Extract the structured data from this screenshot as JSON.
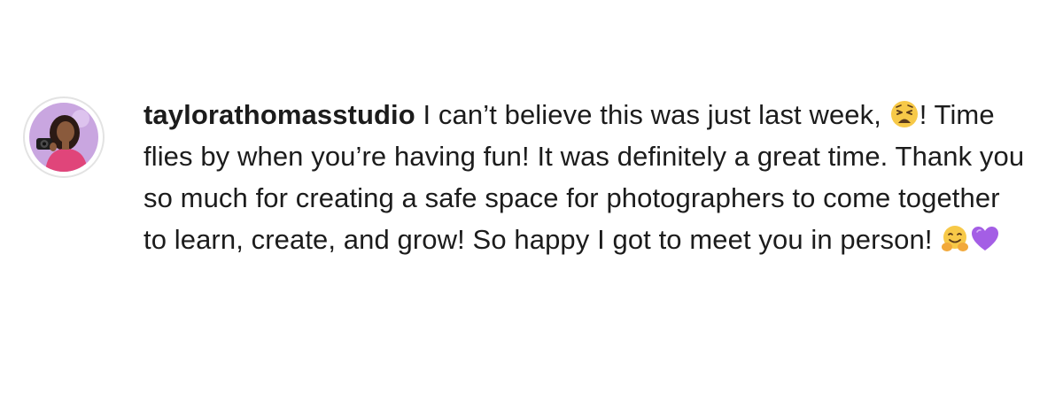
{
  "comment": {
    "username": "taylorathomasstudio",
    "text_part1": " I can’t believe this was just last week, ",
    "text_part2": "! Time flies by when you’re having fun! It was definitely a great time. Thank you so much for creating a safe space for photographers to come together to learn, create, and grow! So happy I got to meet you in person! ",
    "emoji_1": "weary-face-emoji",
    "emoji_2": "hugging-face-emoji",
    "emoji_3": "purple-heart-emoji"
  },
  "colors": {
    "text": "#1c1c1c",
    "avatar_ring": "#e3e3e3",
    "avatar_background": "#c9a6e0",
    "avatar_shirt": "#e0457a",
    "heart": "#a45ee5",
    "emoji_yellow": "#f7c948"
  }
}
